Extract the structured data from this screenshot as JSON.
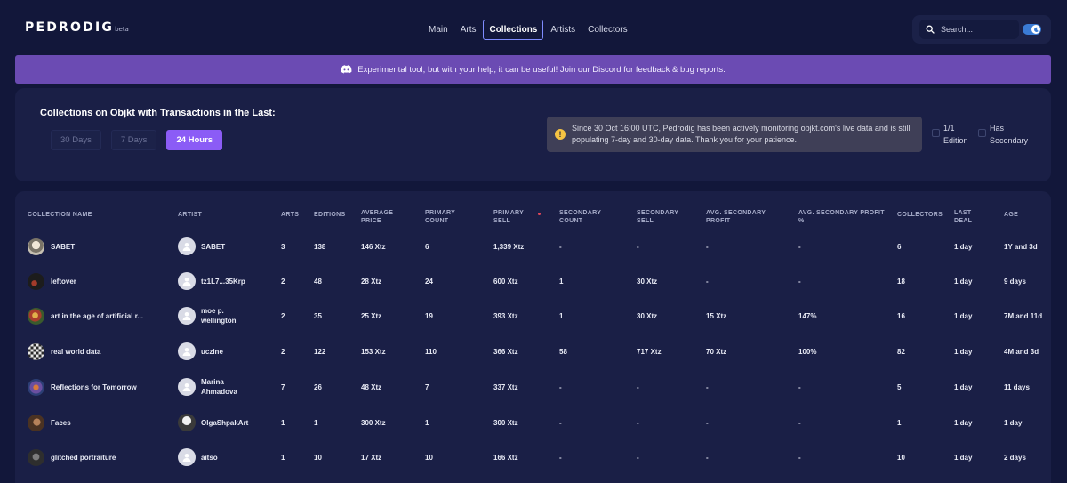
{
  "header": {
    "logo": "PEDRODIG",
    "logo_suffix": "beta",
    "nav": [
      "Main",
      "Arts",
      "Collections",
      "Artists",
      "Collectors"
    ],
    "nav_active": "Collections",
    "search_placeholder": "Search...",
    "theme_toggle_on": true
  },
  "banner": {
    "icon": "discord-icon",
    "text": "Experimental tool, but with your help, it can be useful! Join our Discord for feedback & bug reports."
  },
  "filters": {
    "title": "Collections on Objkt with Transactions in the Last:",
    "ranges": [
      "30 Days",
      "7 Days",
      "24 Hours"
    ],
    "active_range": "24 Hours",
    "notice": "Since 30 Oct 16:00 UTC, Pedrodig has been actively monitoring objkt.com's live data and is still populating 7-day and 30-day data. Thank you for your patience.",
    "edition_label": "1/1 Edition",
    "secondary_label": "Has Secondary"
  },
  "table": {
    "columns": [
      "COLLECTION NAME",
      "ARTIST",
      "ARTS",
      "EDITIONS",
      "AVERAGE PRICE",
      "PRIMARY COUNT",
      "PRIMARY SELL",
      "SECONDARY COUNT",
      "SECONDARY SELL",
      "AVG. SECONDARY PROFIT",
      "AVG. SECONDARY PROFIT %",
      "COLLECTORS",
      "LAST DEAL",
      "AGE"
    ],
    "rows": [
      {
        "name": "SABET",
        "artist": "SABET",
        "arts": "3",
        "editions": "138",
        "avg_price": "146 Xtz",
        "primary_count": "6",
        "primary_sell": "1,339 Xtz",
        "secondary_count": "-",
        "secondary_sell": "-",
        "avg_profit": "-",
        "avg_profit_pct": "-",
        "collectors": "6",
        "last_deal": "1 day",
        "age": "1Y and 3d"
      },
      {
        "name": "leftover",
        "artist": "tz1L7...35Krp",
        "arts": "2",
        "editions": "48",
        "avg_price": "28 Xtz",
        "primary_count": "24",
        "primary_sell": "600 Xtz",
        "secondary_count": "1",
        "secondary_sell": "30 Xtz",
        "avg_profit": "-",
        "avg_profit_pct": "-",
        "collectors": "18",
        "last_deal": "1 day",
        "age": "9 days"
      },
      {
        "name": "art in the age of artificial r...",
        "artist": "moe p. wellington",
        "arts": "2",
        "editions": "35",
        "avg_price": "25 Xtz",
        "primary_count": "19",
        "primary_sell": "393 Xtz",
        "secondary_count": "1",
        "secondary_sell": "30 Xtz",
        "avg_profit": "15 Xtz",
        "avg_profit_pct": "147%",
        "collectors": "16",
        "last_deal": "1 day",
        "age": "7M and 11d"
      },
      {
        "name": "real world data",
        "artist": "uczine",
        "arts": "2",
        "editions": "122",
        "avg_price": "153 Xtz",
        "primary_count": "110",
        "primary_sell": "366 Xtz",
        "secondary_count": "58",
        "secondary_sell": "717 Xtz",
        "avg_profit": "70 Xtz",
        "avg_profit_pct": "100%",
        "collectors": "82",
        "last_deal": "1 day",
        "age": "4M and 3d"
      },
      {
        "name": "Reflections for Tomorrow",
        "artist": "Marina Ahmadova",
        "arts": "7",
        "editions": "26",
        "avg_price": "48 Xtz",
        "primary_count": "7",
        "primary_sell": "337 Xtz",
        "secondary_count": "-",
        "secondary_sell": "-",
        "avg_profit": "-",
        "avg_profit_pct": "-",
        "collectors": "5",
        "last_deal": "1 day",
        "age": "11 days"
      },
      {
        "name": "Faces",
        "artist": "OlgaShpakArt",
        "arts": "1",
        "editions": "1",
        "avg_price": "300 Xtz",
        "primary_count": "1",
        "primary_sell": "300 Xtz",
        "secondary_count": "-",
        "secondary_sell": "-",
        "avg_profit": "-",
        "avg_profit_pct": "-",
        "collectors": "1",
        "last_deal": "1 day",
        "age": "1 day"
      },
      {
        "name": "glitched portraiture",
        "artist": "aitso",
        "arts": "1",
        "editions": "10",
        "avg_price": "17 Xtz",
        "primary_count": "10",
        "primary_sell": "166 Xtz",
        "secondary_count": "-",
        "secondary_sell": "-",
        "avg_profit": "-",
        "avg_profit_pct": "-",
        "collectors": "10",
        "last_deal": "1 day",
        "age": "2 days"
      }
    ]
  },
  "colors": {
    "background": "#12173a",
    "panel": "#1a1f46",
    "banner": "#6b4bb3",
    "accent": "#8b5cf6",
    "nav_active_border": "#7f8cff"
  }
}
